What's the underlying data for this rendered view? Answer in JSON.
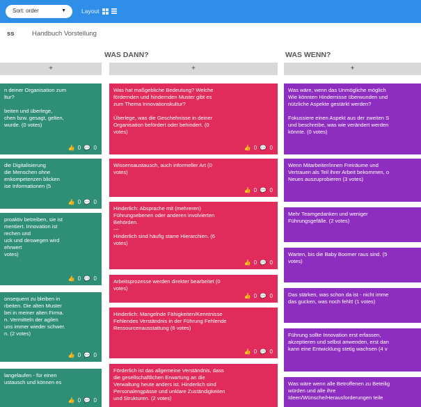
{
  "toolbar": {
    "sort_label": "Sort: order",
    "sort_caret": "▼",
    "layout_label": "Layout"
  },
  "subbar": {
    "crumb": "ss",
    "link": "Handbuch Vorstellung"
  },
  "columns": [
    {
      "title": "",
      "add_label": "+"
    },
    {
      "title": "WAS DANN?",
      "add_label": "+"
    },
    {
      "title": "WAS WENN?",
      "add_label": "+"
    }
  ],
  "card_actions": "👍 0 💬 0",
  "cards": {
    "green": [
      "n deiner Organisation zum\nltur?\n\nbeiten und überlege,\nchen bzw. gesagt, gelten,\nwurde. (0 votes)",
      "die Digitalisierung\ndie Menschen ohne\nenkompetenzen blicken\nise Informationen (5",
      "proaktiv betreiben, sie ist\nmentiert. Innovation ist\nrechen und\nuck und deswegen wird\nehrwert\nvotes)",
      "onsequent zu bleiben in\nrbeiten. Die alten Muster\nbei in meiner alten Firma.\nn. Vermitteln der agilen\nuns immer wieder schwer.\nn. (2 votes)",
      "langelaufen - für einen\nustausch und können es"
    ],
    "red": [
      "Was hat maßgebliche Bedeutung? Welche\nfördernden und hindernden Muster gibt es\nzum Thema Innovationskultur?\n\nÜberlege, was die Geschehnisse in deiner\nOrganisation befördert oder behindert. (0\nvotes)",
      "Wissensaustausch, auch informeller Art (0\nvotes)",
      "Hinderlich: Absprache mit (mehreren)\nFührungsebenen oder anderen involvierten\nBehörden.\n---\nHinderlich sind häufig starre Hierarchien. (6\nvotes)",
      "Arbeitsprozesse werden direkter bearbeitet (0\nvotes)",
      "Hinderlich: Mangelnde Fähigkeiten/Kenntnisse\nFehlendes Verständnis in der Führung Fehlende\nRessourcenausstattung (6 votes)",
      "Förderlich ist das allgemeine Verständnis, dass\ndie gesellschaftlichen Erwartung an die\nVerwaltung heute anders ist. Hinderlich sind\nPersonalengpässe und unklare Zuständigkeiten\nund Strukturen. (2 votes)"
    ],
    "purple": [
      "Was wäre, wenn das Unmögliche möglich\nWie könnten Hindernisse überwunden und\nnützliche Aspekte gestärkt werden?\n\nFokussiere einen Aspekt aus der zweiten S\nund beschreibe, was wie verändert werden\nkönnte. (0 votes)",
      "Wenn Mitarbeiter/innen Freiräume und\nVertrauen als Teil ihrer Arbeit bekommen, o\nNeues auszuprobieren (3 votes)",
      "Mehr Teamgedanken und weniger\nFührungsgefälle. (2 votes)",
      "Warten, bis die Baby Boomer raus sind. (5\nvotes)",
      "Das stärken, was schon da ist - nicht imme\ndas gucken, was noch fehlt! (1 votes)",
      "Führung sollte Innovation erst erfassen,\nakzeptieren und selbst anwenden, erst dan\nkann eine Entwicklung stetig wachsen (4 v",
      "Was wäre wenn alle Betroffenen zu Beteilig\nwürden und alle ihre\nIdeen/Wünsche/Herausforderungen teile"
    ]
  }
}
